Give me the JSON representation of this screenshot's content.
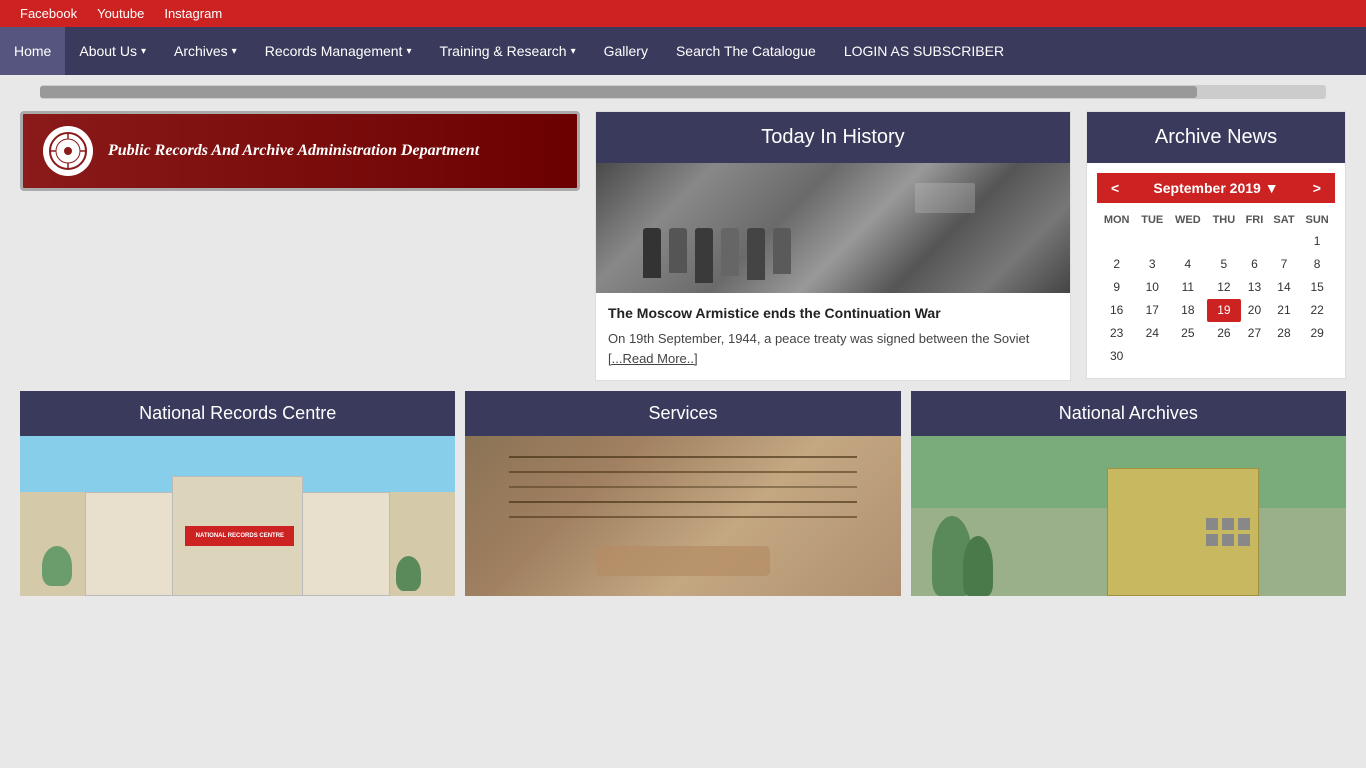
{
  "social": {
    "links": [
      {
        "label": "Facebook",
        "name": "facebook-link"
      },
      {
        "label": "Youtube",
        "name": "youtube-link"
      },
      {
        "label": "Instagram",
        "name": "instagram-link"
      }
    ]
  },
  "nav": {
    "items": [
      {
        "label": "Home",
        "name": "nav-home",
        "dropdown": false
      },
      {
        "label": "About Us",
        "name": "nav-about",
        "dropdown": true
      },
      {
        "label": "Archives",
        "name": "nav-archives",
        "dropdown": true
      },
      {
        "label": "Records Management",
        "name": "nav-records",
        "dropdown": true
      },
      {
        "label": "Training & Research",
        "name": "nav-training",
        "dropdown": true
      },
      {
        "label": "Gallery",
        "name": "nav-gallery",
        "dropdown": false
      },
      {
        "label": "Search The Catalogue",
        "name": "nav-search",
        "dropdown": false
      },
      {
        "label": "LOGIN AS SUBSCRIBER",
        "name": "nav-login",
        "dropdown": false
      }
    ]
  },
  "banner": {
    "text": "Public Records And Archive Administration Department",
    "logo_symbol": "⚙"
  },
  "today_in_history": {
    "heading": "Today In History",
    "title": "The Moscow Armistice ends the Continuation War",
    "body": "On 19th September, 1944, a peace treaty was signed between the Soviet",
    "read_more": "[...Read More..]"
  },
  "archive_news": {
    "heading": "Archive News",
    "calendar": {
      "prev": "<",
      "next": ">",
      "month_year": "September 2019 ▼",
      "day_headers": [
        "MON",
        "TUE",
        "WED",
        "THU",
        "FRI",
        "SAT",
        "SUN"
      ],
      "weeks": [
        [
          "",
          "",
          "",
          "",
          "",
          "",
          "1"
        ],
        [
          "2",
          "3",
          "4",
          "5",
          "6",
          "7",
          "8"
        ],
        [
          "9",
          "10",
          "11",
          "12",
          "13",
          "14",
          "15"
        ],
        [
          "16",
          "17",
          "18",
          "19",
          "20",
          "21",
          "22"
        ],
        [
          "23",
          "24",
          "25",
          "26",
          "27",
          "28",
          "29"
        ],
        [
          "30",
          "",
          "",
          "",
          "",
          "",
          ""
        ]
      ],
      "today": "19"
    }
  },
  "bottom_sections": [
    {
      "label": "National Records Centre",
      "name": "national-records-centre"
    },
    {
      "label": "Services",
      "name": "services"
    },
    {
      "label": "National Archives",
      "name": "national-archives"
    }
  ]
}
